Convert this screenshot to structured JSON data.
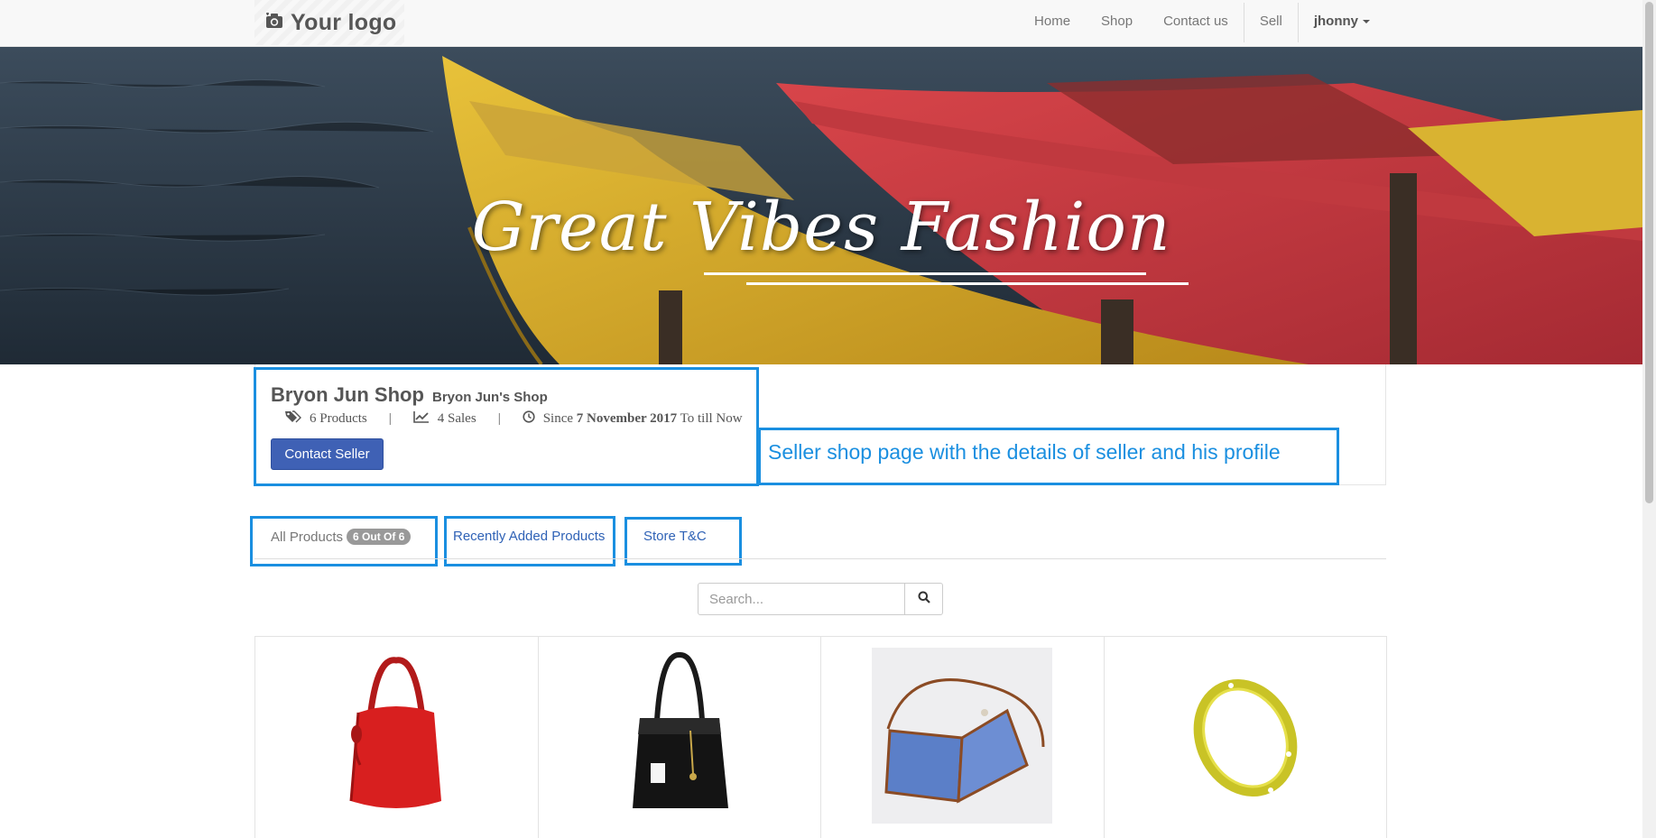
{
  "navbar": {
    "logo_text": "Your logo",
    "logo_icon": "camera-icon",
    "links": [
      "Home",
      "Shop",
      "Contact us"
    ],
    "sell": "Sell",
    "user": "jhonny"
  },
  "banner": {
    "title": "Great Vibes Fashion"
  },
  "shop": {
    "name": "Bryon Jun Shop",
    "subtitle": "Bryon Jun's Shop",
    "products": "6 Products",
    "sales": "4 Sales",
    "since_prefix": "Since",
    "since_date": "7 November 2017",
    "since_suffix": "To till Now",
    "contact_button": "Contact Seller"
  },
  "annotation": {
    "note": "Seller shop page with the details of seller and his profile",
    "highlight_color": "#1a8fe0"
  },
  "tabs": {
    "all_products": "All Products",
    "all_badge": "6 Out Of 6",
    "recent": "Recently Added Products",
    "terms": "Store T&C"
  },
  "search": {
    "placeholder": "Search..."
  },
  "products": [
    {
      "kind": "red-handbag"
    },
    {
      "kind": "black-handbag"
    },
    {
      "kind": "blue-shoulder-bag"
    },
    {
      "kind": "gold-bangle"
    }
  ],
  "colors": {
    "primary_button": "#3f61b5",
    "link": "#2f62b6",
    "navbar_bg": "#f8f8f8"
  }
}
